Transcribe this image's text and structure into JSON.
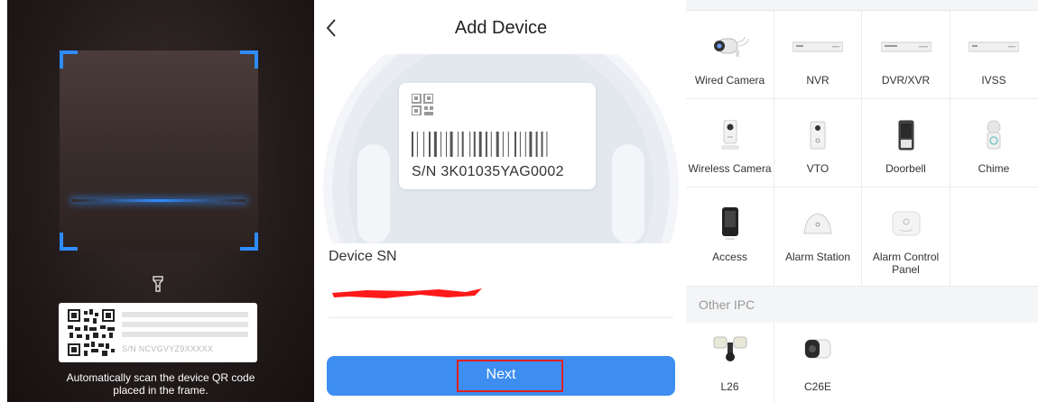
{
  "scanner": {
    "label_sn": "S/N  NCVGVYZ9XXXXX",
    "hint_line1": "Automatically scan the device QR code",
    "hint_line2": "placed in the frame.",
    "accent_color": "#2f8cff"
  },
  "add_device": {
    "title": "Add Device",
    "sample_sn": "S/N  3K01035YAG0002",
    "device_sn_label": "Device SN",
    "next_label": "Next",
    "button_color": "#3d8ef0",
    "highlight_color": "#e02020"
  },
  "device_grid": {
    "devices": [
      {
        "label": "Wired Camera",
        "icon": "bullet-camera-icon"
      },
      {
        "label": "NVR",
        "icon": "nvr-recorder-icon"
      },
      {
        "label": "DVR/XVR",
        "icon": "dvr-recorder-icon"
      },
      {
        "label": "IVSS",
        "icon": "ivss-recorder-icon"
      },
      {
        "label": "Wireless Camera",
        "icon": "wireless-camera-icon"
      },
      {
        "label": "VTO",
        "icon": "vto-icon"
      },
      {
        "label": "Doorbell",
        "icon": "doorbell-icon"
      },
      {
        "label": "Chime",
        "icon": "chime-icon"
      },
      {
        "label": "Access",
        "icon": "access-control-icon"
      },
      {
        "label": "Alarm Station",
        "icon": "alarm-station-icon"
      },
      {
        "label": "Alarm Control Panel",
        "icon": "alarm-control-panel-icon"
      }
    ],
    "other_ipc_title": "Other IPC",
    "other_ipc": [
      {
        "label": "L26",
        "icon": "floodlight-camera-icon"
      },
      {
        "label": "C26E",
        "icon": "cube-camera-icon"
      }
    ]
  }
}
